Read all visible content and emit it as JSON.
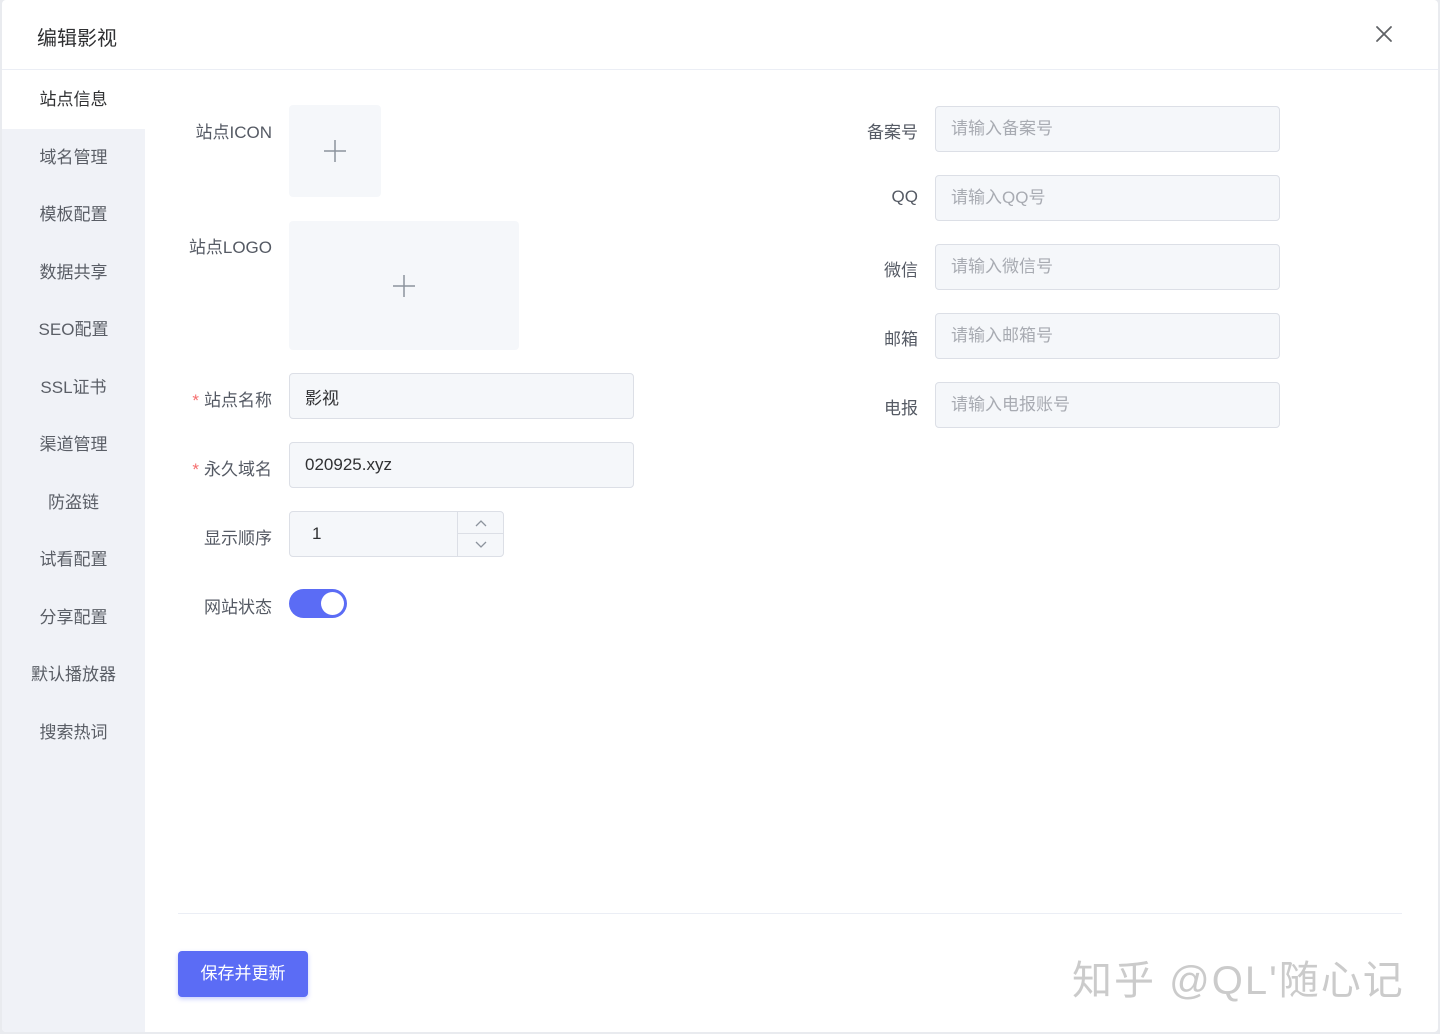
{
  "dialog": {
    "title": "编辑影视"
  },
  "sidebar": {
    "items": [
      {
        "label": "站点信息"
      },
      {
        "label": "域名管理"
      },
      {
        "label": "模板配置"
      },
      {
        "label": "数据共享"
      },
      {
        "label": "SEO配置"
      },
      {
        "label": "SSL证书"
      },
      {
        "label": "渠道管理"
      },
      {
        "label": "防盗链"
      },
      {
        "label": "试看配置"
      },
      {
        "label": "分享配置"
      },
      {
        "label": "默认播放器"
      },
      {
        "label": "搜索热词"
      }
    ],
    "active_index": 0
  },
  "form_left": {
    "icon_label": "站点ICON",
    "logo_label": "站点LOGO",
    "site_name": {
      "label": "站点名称",
      "required_mark": "*",
      "value": "影视"
    },
    "domain": {
      "label": "永久域名",
      "required_mark": "*",
      "value": "020925.xyz"
    },
    "order": {
      "label": "显示顺序",
      "value": "1"
    },
    "status": {
      "label": "网站状态",
      "enabled": true
    }
  },
  "form_right": {
    "icp": {
      "label": "备案号",
      "placeholder": "请输入备案号"
    },
    "qq": {
      "label": "QQ",
      "placeholder": "请输入QQ号"
    },
    "wechat": {
      "label": "微信",
      "placeholder": "请输入微信号"
    },
    "email": {
      "label": "邮箱",
      "placeholder": "请输入邮箱号"
    },
    "telegram": {
      "label": "电报",
      "placeholder": "请输入电报账号"
    }
  },
  "footer": {
    "save_label": "保存并更新"
  },
  "watermark": "知乎 @QL'随心记",
  "colors": {
    "primary": "#5b6cf5",
    "required": "#f56c6c",
    "sidebar_bg": "#f0f2f7"
  },
  "icons": [
    "close-icon",
    "plus-icon",
    "chevron-up-icon",
    "chevron-down-icon"
  ]
}
